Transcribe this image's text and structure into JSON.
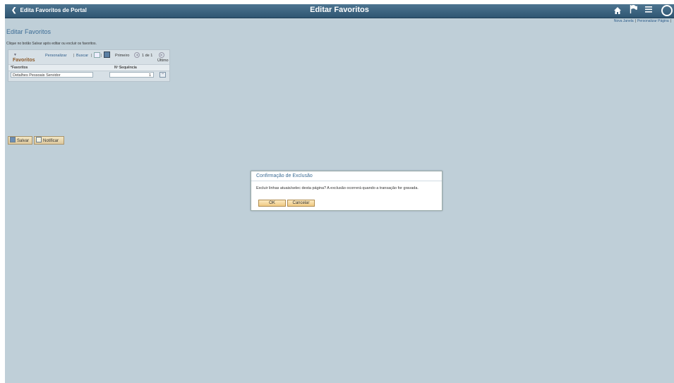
{
  "topbar": {
    "back_label": "Edita Favoritos de Portal",
    "title": "Editar Favoritos",
    "icons": [
      "home-icon",
      "flag-icon",
      "menu-icon",
      "navbar-icon"
    ]
  },
  "toplinks": {
    "new_window": "Nova Janela",
    "personalize": "Personalizar Página",
    "separator": "|"
  },
  "page": {
    "title": "Editar Favoritos",
    "instruction": "Clique no botão Salvar após editar ou excluir os favoritos."
  },
  "grid": {
    "title": "Favoritos",
    "personalizar": "Personalizar",
    "buscar": "Buscar",
    "separator": "|",
    "first": "Primeiro",
    "count": "1 de 1",
    "last": "Último",
    "columns": [
      "*Favoritos",
      "Nº Sequência"
    ],
    "rows": [
      {
        "favorito": "Detalhes Pessoais Servidor",
        "sequencia": "1"
      }
    ],
    "delete_row_symbol": "−"
  },
  "actions": {
    "save": "Salvar",
    "notify": "Notificar"
  },
  "dialog": {
    "title": "Confirmação de Exclusão",
    "message": "Excluir linhas atuais/selec desta página? A exclusão ocorrerá quando a transação for gravada.",
    "ok": "OK",
    "cancel": "Cancelar"
  },
  "colors": {
    "topbar": "#3a6280",
    "background": "#bfcfd8",
    "link": "#2d5c8a",
    "title": "#3c6c95",
    "button": "#f0c982"
  }
}
